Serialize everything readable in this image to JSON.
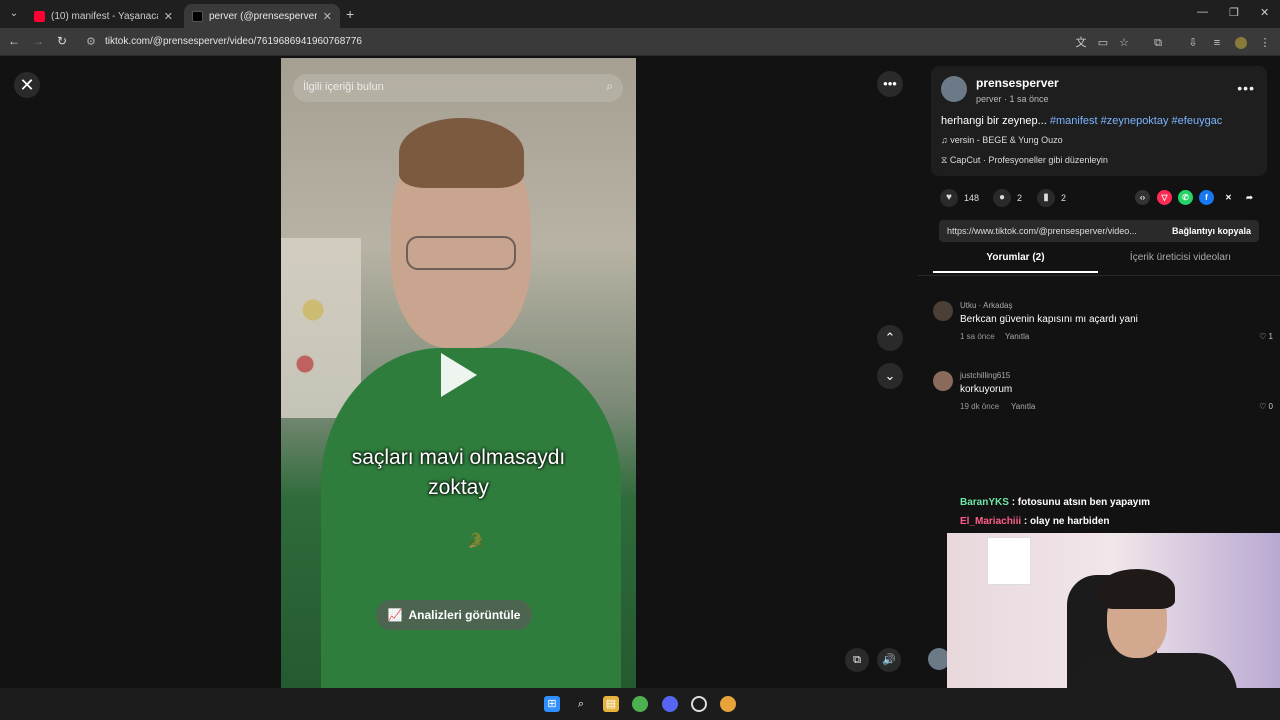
{
  "browser": {
    "tabs": [
      {
        "title": "(10) manifest - Yaşanacaksa | O",
        "favicon_color": "#ff0033",
        "active": false
      },
      {
        "title": "perver (@prensesperver) | TikTo",
        "favicon_color": "#000000",
        "active": true
      }
    ],
    "url": "tiktok.com/@prensesperver/video/7619686941960768776"
  },
  "video": {
    "search_placeholder": "İlgili içeriği bulun",
    "caption_line1": "saçları mavi olmasaydı",
    "caption_line2": "zoktay",
    "analytics_label": "Analizleri görüntüle"
  },
  "post": {
    "username": "prensesperver",
    "meta": "perver · 1 sa önce",
    "description": "herhangi bir zeynep...",
    "hashtags": "#manifest #zeynepoktay #efeuygac",
    "music": "versin - BEGE & Yung Ouzo",
    "capcut": "CapCut · Profesyoneller gibi düzenleyin",
    "likes": "148",
    "comments": "2",
    "saves": "2",
    "link": "https://www.tiktok.com/@prensesperver/video...",
    "copy_label": "Bağlantıyı kopyala"
  },
  "panel_tabs": {
    "comments": "Yorumlar (2)",
    "creator_videos": "İçerik üreticisi videoları"
  },
  "comments": [
    {
      "user": "Utku · Arkadaş",
      "text": "Berkcan güvenin kapısını mı açardı yani",
      "time": "1 sa önce",
      "reply": "Yanıtla",
      "likes": "1"
    },
    {
      "user": "justchilling615",
      "text": "korkuyorum",
      "time": "19 dk önce",
      "reply": "Yanıtla",
      "likes": "0"
    }
  ],
  "stream_chat": [
    {
      "name": "BaranYKS",
      "message": ": fotosunu atsın ben yapayım",
      "color": "#6ee7a8"
    },
    {
      "name": "El_Mariachiii",
      "message": ": olay ne harbiden",
      "color": "#ff5c8a"
    }
  ],
  "colors": {
    "accent_red": "#fe2c55",
    "hashtag": "#7bb3ff"
  }
}
